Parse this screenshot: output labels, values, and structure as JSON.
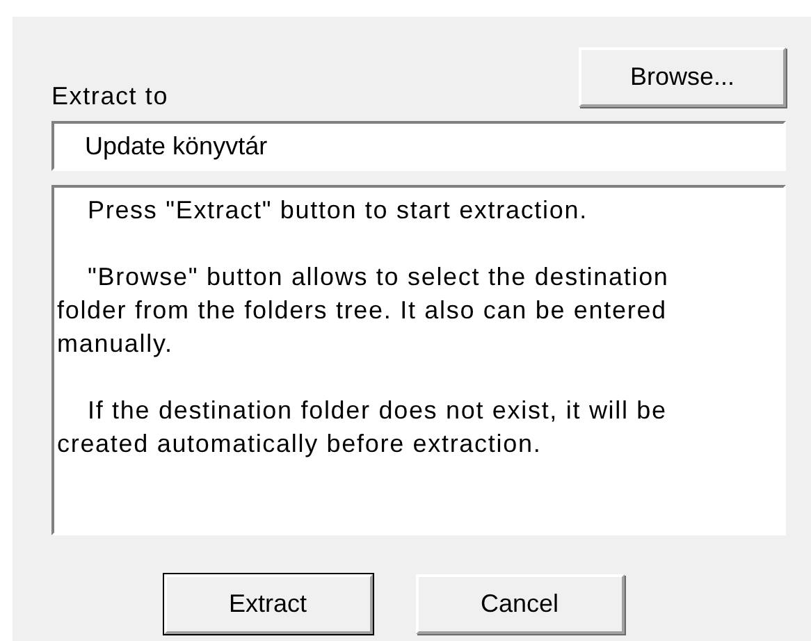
{
  "destination": {
    "label": "Extract to",
    "value": "Update könyvtár"
  },
  "browse_button": {
    "label": "Browse..."
  },
  "info_text": [
    "Press \"Extract\" button to start extraction.",
    "\"Browse\" button allows to select the destination folder from the folders tree. It also can be entered manually.",
    "If the destination folder does not exist, it will be created automatically before extraction."
  ],
  "buttons": [
    {
      "label": "Extract",
      "default": true
    },
    {
      "label": "Cancel",
      "default": false
    }
  ]
}
